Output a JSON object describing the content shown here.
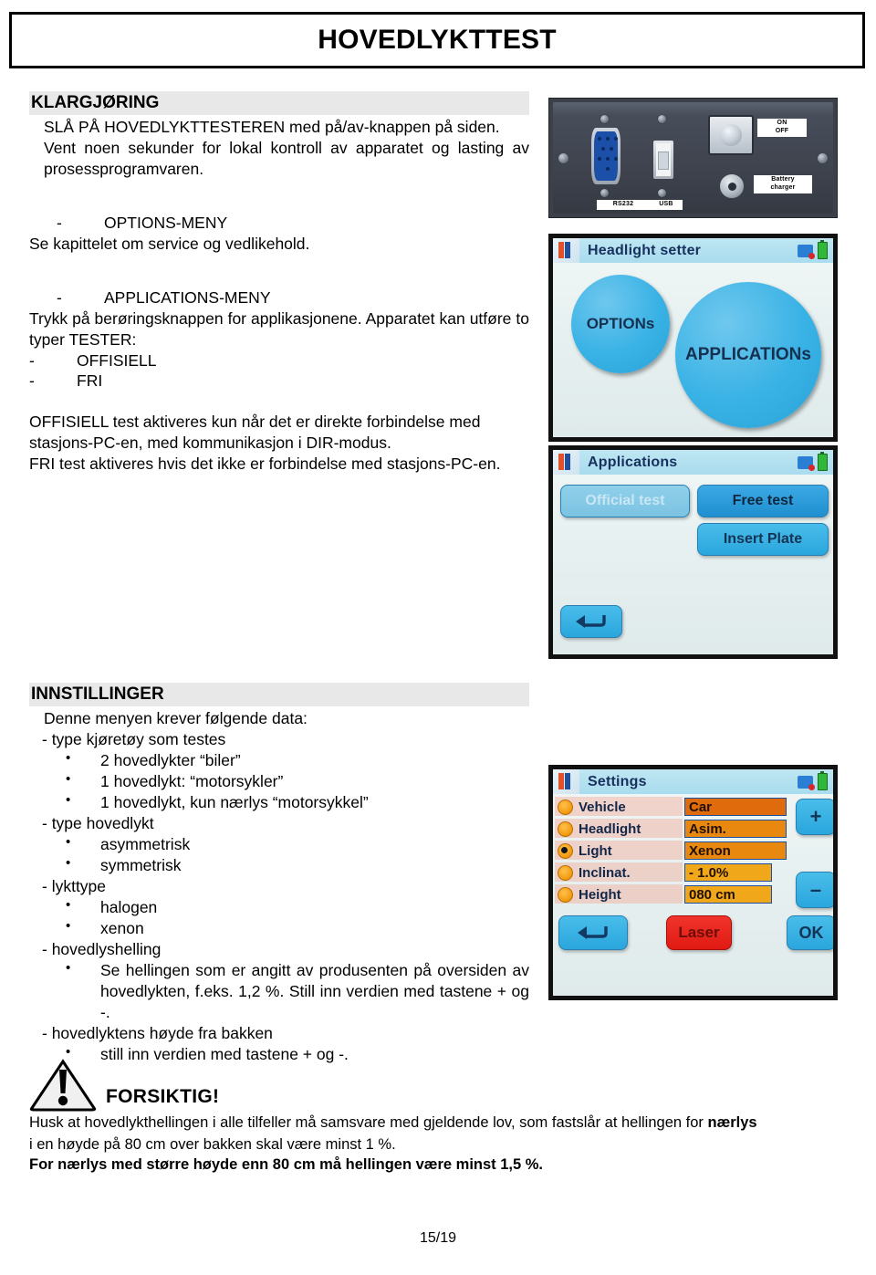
{
  "document": {
    "title": "HOVEDLYKTTEST",
    "page_number": "15/19"
  },
  "sections": {
    "klargjoring": {
      "heading": "KLARGJØRING",
      "paragraphs": [
        "SLÅ PÅ HOVEDLYKTTESTEREN med på/av-knappen på siden.",
        "Vent noen sekunder for lokal kontroll av apparatet og lasting av prosessprogramvaren."
      ]
    },
    "options_menu": {
      "dash": "-",
      "label": "OPTIONS-MENY",
      "paragraph": "Se kapittelet om service og vedlikehold."
    },
    "applications_menu": {
      "dash": "-",
      "label": "APPLICATIONS-MENY",
      "intro": "Trykk på berøringsknappen for applikasjonene. Apparatet kan utføre to typer TESTER:",
      "items": [
        {
          "dash": "-",
          "label": "OFFISIELL"
        },
        {
          "dash": "-",
          "label": "FRI"
        }
      ],
      "note1": "OFFISIELL test aktiveres kun når det er direkte forbindelse med stasjons-PC-en, med kommunikasjon i DIR-modus.",
      "note2": "FRI test aktiveres hvis det ikke er forbindelse med stasjons-PC-en."
    },
    "innstillinger": {
      "heading": "INNSTILLINGER",
      "intro": "Denne menyen krever følgende data:",
      "groups": [
        {
          "label": "- type kjøretøy som testes",
          "bullets": [
            "2 hovedlykter “biler”",
            "1 hovedlykt: “motorsykler”",
            "1 hovedlykt, kun nærlys “motorsykkel”"
          ]
        },
        {
          "label": "- type hovedlykt",
          "bullets": [
            "asymmetrisk",
            "symmetrisk"
          ]
        },
        {
          "label": "- lykttype",
          "bullets": [
            "halogen",
            "xenon"
          ]
        },
        {
          "label": "- hovedlyshelling",
          "bullets": [
            "Se hellingen som er angitt av produsenten på oversiden av hovedlykten, f.eks. 1,2 %. Still inn verdien med tastene + og -."
          ]
        },
        {
          "label": "- hovedlyktens høyde fra bakken",
          "bullets": [
            "still inn verdien med tastene + og -."
          ]
        }
      ]
    },
    "warning": {
      "caption": "FORSIKTIG!",
      "line1_a": "Husk at hovedlykthellingen i alle tilfeller må samsvare med gjeldende lov, som fastslår at hellingen for ",
      "line1_b": "nærlys",
      "line2": "i en høyde på 80 cm over bakken skal være minst 1 %.",
      "line3": "For nærlys med større høyde enn 80 cm må hellingen være minst 1,5 %."
    }
  },
  "hardware_photo": {
    "labels": {
      "rs232": "RS232",
      "usb": "USB",
      "on_off": "ON\nOFF",
      "battery_charger": "Battery\ncharger"
    }
  },
  "screens": {
    "headlight_setter": {
      "title": "Headlight setter",
      "buttons": [
        {
          "label": "OPTIONs"
        },
        {
          "label": "APPLICATIONs"
        }
      ]
    },
    "applications": {
      "title": "Applications",
      "buttons": [
        {
          "label": "Official test",
          "state": "disabled"
        },
        {
          "label": "Free test",
          "state": "enabled"
        },
        {
          "label": "Insert Plate",
          "state": "enabled"
        }
      ],
      "back_icon": "back-arrow-icon"
    },
    "settings": {
      "title": "Settings",
      "rows": [
        {
          "label": "Vehicle",
          "value": "Car",
          "selected": false
        },
        {
          "label": "Headlight",
          "value": "Asim.",
          "selected": false
        },
        {
          "label": "Light",
          "value": "Xenon",
          "selected": true
        },
        {
          "label": "Inclinat.",
          "value": "- 1.0%",
          "selected": false
        },
        {
          "label": "Height",
          "value": "080 cm",
          "selected": false
        }
      ],
      "plus_label": "+",
      "minus_label": "–",
      "laser_label": "Laser",
      "ok_label": "OK",
      "back_icon": "back-arrow-icon"
    }
  },
  "colors": {
    "screen_blue": "#2aa6dd",
    "screen_header": "#a8dcee",
    "value_orange": "#e07b11",
    "laser_red": "#e01a12",
    "heading_gray": "#e8e8e8"
  }
}
